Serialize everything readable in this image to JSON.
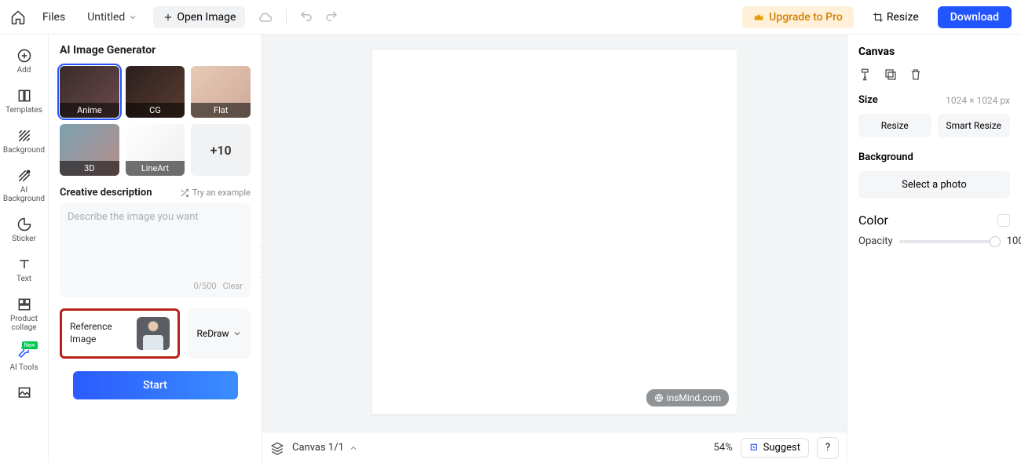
{
  "topbar": {
    "files": "Files",
    "title": "Untitled",
    "open_image": "Open Image",
    "upgrade": "Upgrade to Pro",
    "resize": "Resize",
    "download": "Download"
  },
  "rail": {
    "add": "Add",
    "templates": "Templates",
    "background": "Background",
    "ai_background": "AI\nBackground",
    "sticker": "Sticker",
    "text": "Text",
    "product_collage": "Product\ncollage",
    "ai_tools": "AI Tools",
    "ai_badge": "New"
  },
  "panel": {
    "title": "AI Image Generator",
    "styles": [
      {
        "label": "Anime",
        "selected": true
      },
      {
        "label": "CG"
      },
      {
        "label": "Flat"
      },
      {
        "label": "3D"
      },
      {
        "label": "LineArt"
      }
    ],
    "more_tile": "+10",
    "creative_desc_title": "Creative description",
    "try_example": "Try an example",
    "placeholder": "Describe the image you want",
    "counter": "0/500",
    "clear": "Clear",
    "ref_label": "Reference\nImage",
    "redraw": "ReDraw",
    "start": "Start"
  },
  "canvas": {
    "watermark": "insMind.com",
    "canvas_info": "Canvas 1/1",
    "zoom": "54%",
    "suggest": "Suggest",
    "help": "?"
  },
  "props": {
    "title": "Canvas",
    "size_label": "Size",
    "size_value": "1024 × 1024 px",
    "resize": "Resize",
    "smart_resize": "Smart Resize",
    "background_label": "Background",
    "select_photo": "Select a photo",
    "color_label": "Color",
    "opacity_label": "Opacity",
    "opacity_value": "100"
  }
}
